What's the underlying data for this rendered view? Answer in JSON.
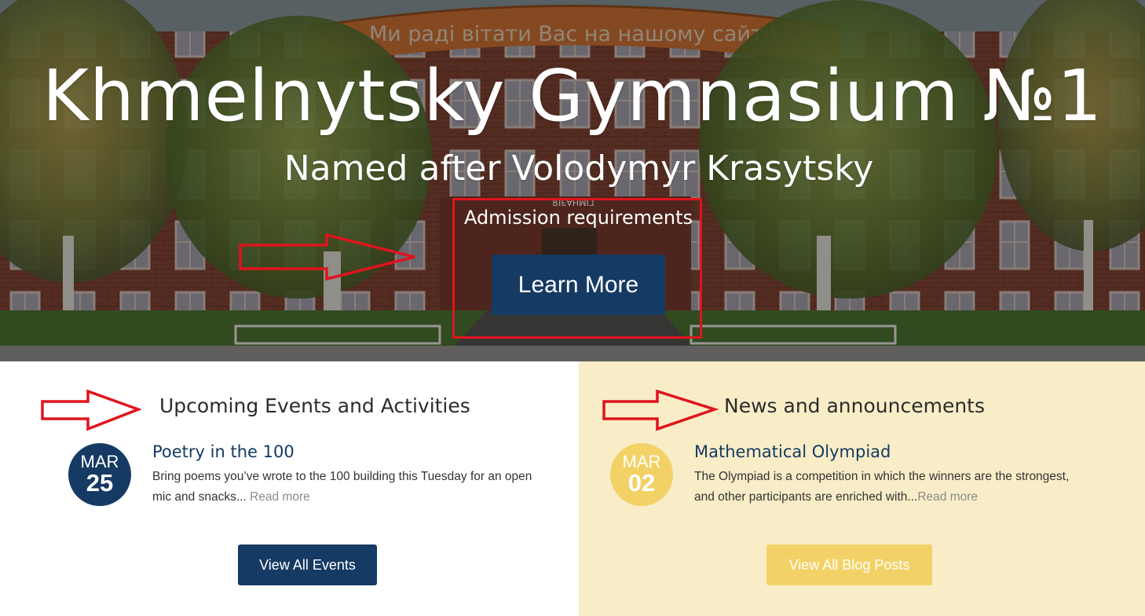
{
  "hero": {
    "banner_text": "Ми раді вітати Вас на нашому сайті!",
    "building_sign": "ГІМНАЗІЯ",
    "title": "Khmelnytsky Gymnasium №1",
    "subtitle": "Named after Volodymyr Krasytsky",
    "admission_link": "Admission requirements",
    "learn_more_label": "Learn More"
  },
  "events": {
    "heading": "Upcoming Events and Activities",
    "items": [
      {
        "month": "MAR",
        "day": "25",
        "title": "Poetry in the 100",
        "excerpt": "Bring poems you’ve wrote to the 100 building this Tuesday for an open mic and snacks...",
        "read_more": "Read more"
      }
    ],
    "view_all_label": "View All Events"
  },
  "news": {
    "heading": "News and announcements",
    "items": [
      {
        "month": "MAR",
        "day": "02",
        "title": "Mathematical Olympiad",
        "excerpt": "The Olympiad is a competition in which the winners are the strongest, and other participants are enriched with...",
        "read_more": "Read more"
      }
    ],
    "view_all_label": "View All Blog Posts"
  },
  "colors": {
    "primary_navy": "#153a63",
    "accent_gold": "#f2d266",
    "news_panel_bg": "#f8edc7",
    "annotation_red": "#e0141e"
  },
  "icons": {
    "annotation": "right-arrow-outline-icon"
  }
}
